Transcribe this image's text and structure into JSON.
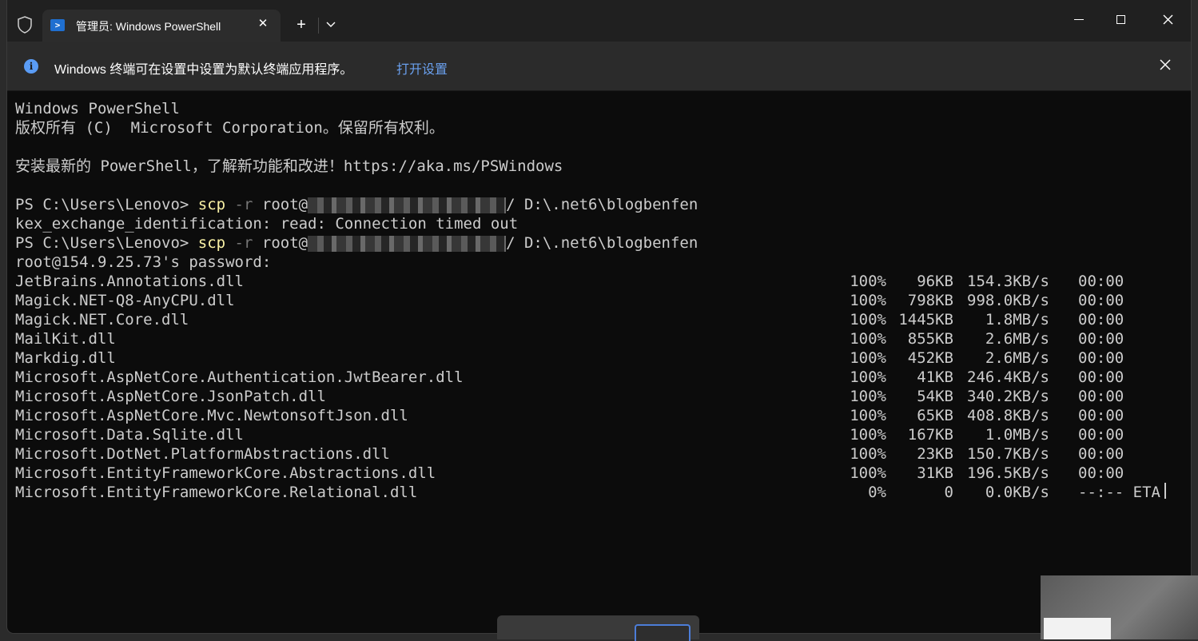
{
  "window": {
    "tab_title": "管理员: Windows PowerShell",
    "tab_icon": "powershell-icon",
    "new_tab_label": "+",
    "dropdown_label": "⌄",
    "close_tab_label": "✕"
  },
  "infobar": {
    "message": "Windows 终端可在设置中设置为默认终端应用程序。",
    "link": "打开设置",
    "icon": "info-icon"
  },
  "terminal": {
    "header1": "Windows PowerShell",
    "header2": "版权所有 (C)  Microsoft Corporation。保留所有权利。",
    "install_msg": "安装最新的 PowerShell，了解新功能和改进！https://aka.ms/PSWindows",
    "prompt": "PS C:\\Users\\Lenovo> ",
    "cmd": "scp",
    "flag": " -r ",
    "cmd_target_prefix": "root@",
    "cmd_dest": "/ D:\\.net6\\blogbenfen",
    "error_line": "kex_exchange_identification: read: Connection timed out",
    "password_prompt": "root@154.9.25.73's password:"
  },
  "transfers": [
    {
      "name": "JetBrains.Annotations.dll",
      "percent": "100%",
      "size": "96KB",
      "rate": "154.3KB/s",
      "eta": "00:00"
    },
    {
      "name": "Magick.NET-Q8-AnyCPU.dll",
      "percent": "100%",
      "size": "798KB",
      "rate": "998.0KB/s",
      "eta": "00:00"
    },
    {
      "name": "Magick.NET.Core.dll",
      "percent": "100%",
      "size": "1445KB",
      "rate": "1.8MB/s",
      "eta": "00:00"
    },
    {
      "name": "MailKit.dll",
      "percent": "100%",
      "size": "855KB",
      "rate": "2.6MB/s",
      "eta": "00:00"
    },
    {
      "name": "Markdig.dll",
      "percent": "100%",
      "size": "452KB",
      "rate": "2.6MB/s",
      "eta": "00:00"
    },
    {
      "name": "Microsoft.AspNetCore.Authentication.JwtBearer.dll",
      "percent": "100%",
      "size": "41KB",
      "rate": "246.4KB/s",
      "eta": "00:00"
    },
    {
      "name": "Microsoft.AspNetCore.JsonPatch.dll",
      "percent": "100%",
      "size": "54KB",
      "rate": "340.2KB/s",
      "eta": "00:00"
    },
    {
      "name": "Microsoft.AspNetCore.Mvc.NewtonsoftJson.dll",
      "percent": "100%",
      "size": "65KB",
      "rate": "408.8KB/s",
      "eta": "00:00"
    },
    {
      "name": "Microsoft.Data.Sqlite.dll",
      "percent": "100%",
      "size": "167KB",
      "rate": "1.0MB/s",
      "eta": "00:00"
    },
    {
      "name": "Microsoft.DotNet.PlatformAbstractions.dll",
      "percent": "100%",
      "size": "23KB",
      "rate": "150.7KB/s",
      "eta": "00:00"
    },
    {
      "name": "Microsoft.EntityFrameworkCore.Abstractions.dll",
      "percent": "100%",
      "size": "31KB",
      "rate": "196.5KB/s",
      "eta": "00:00"
    },
    {
      "name": "Microsoft.EntityFrameworkCore.Relational.dll",
      "percent": "0%",
      "size": "0",
      "rate": "0.0KB/s",
      "eta": "--:-- ETA"
    }
  ]
}
